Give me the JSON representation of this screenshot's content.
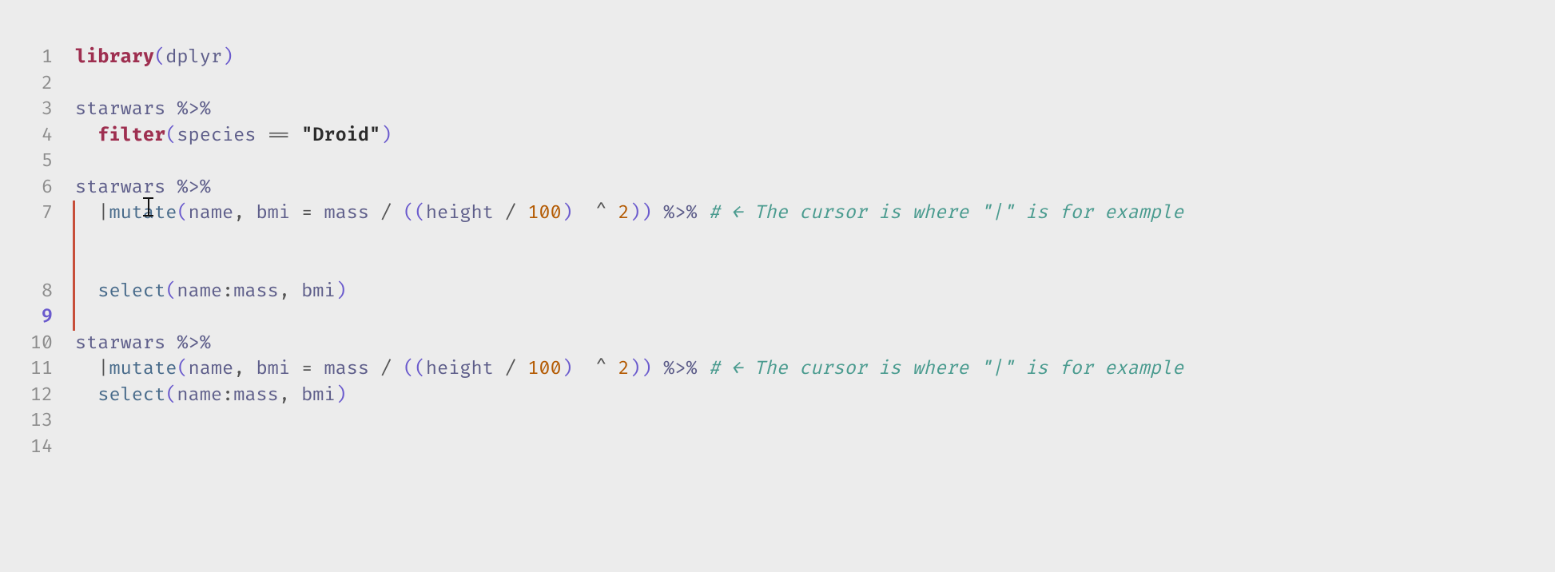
{
  "lines": [
    {
      "n": "1",
      "active": false,
      "mod": false
    },
    {
      "n": "2",
      "active": false,
      "mod": false
    },
    {
      "n": "3",
      "active": false,
      "mod": false
    },
    {
      "n": "4",
      "active": false,
      "mod": false
    },
    {
      "n": "5",
      "active": false,
      "mod": false
    },
    {
      "n": "6",
      "active": false,
      "mod": false
    },
    {
      "n": "7",
      "active": false,
      "mod": true
    },
    {
      "n": "8",
      "active": false,
      "mod": true
    },
    {
      "n": "9",
      "active": true,
      "mod": true
    },
    {
      "n": "10",
      "active": false,
      "mod": false
    },
    {
      "n": "11",
      "active": false,
      "mod": false
    },
    {
      "n": "12",
      "active": false,
      "mod": false
    },
    {
      "n": "13",
      "active": false,
      "mod": false
    },
    {
      "n": "14",
      "active": false,
      "mod": false
    }
  ],
  "tok": {
    "library": "library",
    "dplyr": "dplyr",
    "starwars": "starwars",
    "pipe": "%>%",
    "filter": "filter",
    "species": "species",
    "eq": "==",
    "droid": "\"Droid\"",
    "mutate": "mutate",
    "name": "name",
    "bmi": "bmi",
    "assign": "=",
    "mass_id": "mass",
    "slash": "/",
    "height": "height",
    "hundred": "100",
    "caret": "^",
    "two": "2",
    "select": "select",
    "colon": ":",
    "comma": ",",
    "lpar": "(",
    "rpar": ")",
    "bar": "|",
    "cmt_arrow": "# ← The cursor is where \"|\" is for example"
  }
}
